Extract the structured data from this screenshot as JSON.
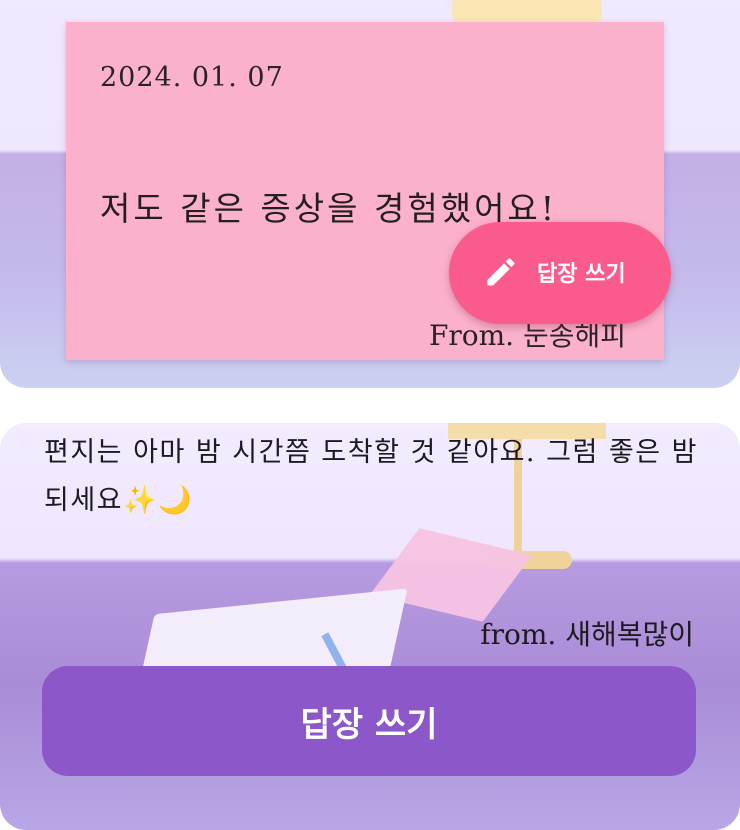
{
  "top_card": {
    "note": {
      "date": "2024. 01. 07",
      "message": "저도 같은 증상을 경험했어요!",
      "from": "From. 눈송해피",
      "color": "#fbb1cc"
    },
    "fab": {
      "label": "답장 쓰기",
      "icon": "pencil-icon",
      "color": "#fa5b8d"
    }
  },
  "bottom_card": {
    "letter_text": "편지는 아마 밤 시간쯤 도착할 것 같아요. 그럼 좋은 밤 되세요✨🌙",
    "from": "from. 새해복많이",
    "reply_button": {
      "label": "답장 쓰기",
      "color": "#8c57c8"
    }
  }
}
